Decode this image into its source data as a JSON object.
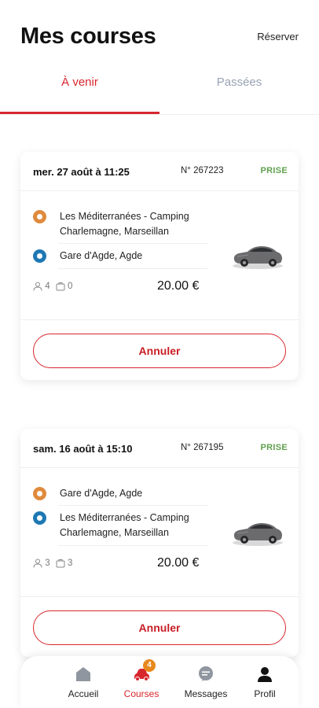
{
  "header": {
    "title": "Mes courses",
    "reserve_label": "Réserver"
  },
  "tabs": [
    {
      "label": "À venir",
      "active": true
    },
    {
      "label": "Passées",
      "active": false
    }
  ],
  "rides": [
    {
      "date": "mer. 27 août à 11:25",
      "number": "N° 267223",
      "status": "PRISE",
      "stops": [
        {
          "type": "origin",
          "text": "Les Méditerranées - Camping Charlemagne, Marseillan"
        },
        {
          "type": "destination",
          "text": "Gare d'Agde, Agde"
        }
      ],
      "passengers": "4",
      "luggage": "0",
      "price": "20.00 €",
      "cancel_label": "Annuler"
    },
    {
      "date": "sam. 16 août à 15:10",
      "number": "N° 267195",
      "status": "PRISE",
      "stops": [
        {
          "type": "origin",
          "text": "Gare d'Agde, Agde"
        },
        {
          "type": "destination",
          "text": "Les Méditerranées - Camping Charlemagne, Marseillan"
        }
      ],
      "passengers": "3",
      "luggage": "3",
      "price": "20.00 €",
      "cancel_label": "Annuler"
    }
  ],
  "nav": [
    {
      "label": "Accueil",
      "icon": "home-icon",
      "active": false
    },
    {
      "label": "Courses",
      "icon": "car-icon",
      "active": true,
      "badge": "4"
    },
    {
      "label": "Messages",
      "icon": "chat-icon",
      "active": false
    },
    {
      "label": "Profil",
      "icon": "user-icon",
      "active": false
    }
  ],
  "colors": {
    "accent": "#d7262d",
    "status_green": "#5fa04e",
    "origin_pin": "#e08a3c",
    "destination_pin": "#1e78b4",
    "badge": "#e8891d"
  }
}
